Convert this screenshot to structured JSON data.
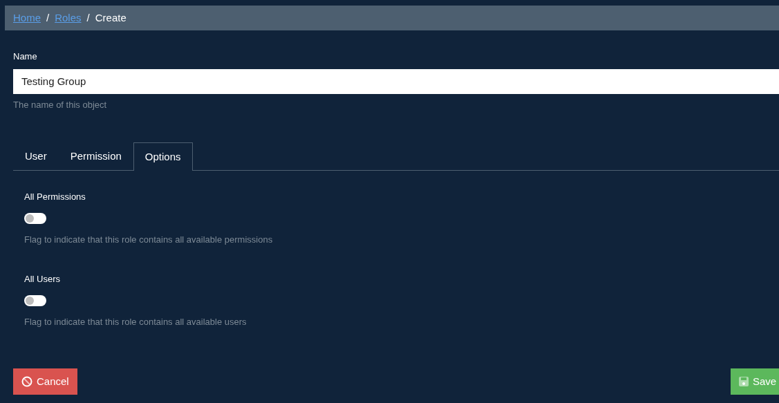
{
  "breadcrumb": [
    {
      "label": "Home",
      "kind": "link"
    },
    {
      "label": "/",
      "kind": "separator"
    },
    {
      "label": "Roles",
      "kind": "link"
    },
    {
      "label": "/",
      "kind": "separator"
    },
    {
      "label": "Create",
      "kind": "current"
    }
  ],
  "name_field": {
    "label": "Name",
    "value": "Testing Group",
    "hint": "The name of this object"
  },
  "tabs": [
    {
      "label": "User",
      "selected": false
    },
    {
      "label": "Permission",
      "selected": false
    },
    {
      "label": "Options",
      "selected": true
    }
  ],
  "options": [
    {
      "label": "All Permissions",
      "on": false,
      "hint": "Flag to indicate that this role contains all available permissions"
    },
    {
      "label": "All Users",
      "on": false,
      "hint": "Flag to indicate that this role contains all available users"
    }
  ],
  "buttons": {
    "cancel": "Cancel",
    "save": "Save"
  }
}
